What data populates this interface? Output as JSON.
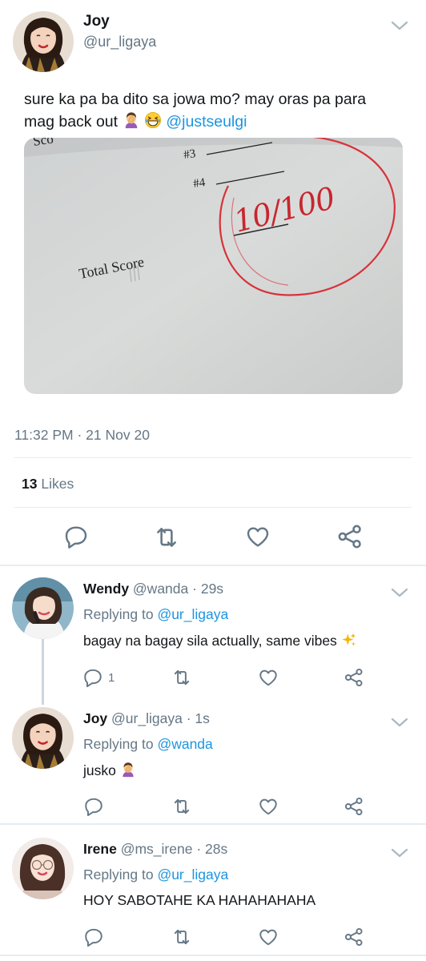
{
  "main_tweet": {
    "author_name": "Joy",
    "author_handle": "@ur_ligaya",
    "text_line1": "sure ka pa ba dito sa jowa mo? may oras pa para",
    "text_line2_prefix": "mag back out",
    "mention": "@justseulgi",
    "emojis": [
      "person-facepalming-emoji",
      "grinning-squinting-face-emoji"
    ],
    "image": {
      "label_score": "Sco",
      "label_3": "#3",
      "label_4": "#4",
      "label_total": "Total Score",
      "score": "10/100"
    },
    "timestamp": "11:32 PM · 21 Nov 20",
    "likes_count": "13",
    "likes_label": "Likes",
    "actions": [
      "reply-icon",
      "retweet-icon",
      "like-icon",
      "share-icon"
    ]
  },
  "replies": [
    {
      "author_name": "Wendy",
      "author_handle": "@wanda",
      "time": "· 29s",
      "replying_label": "Replying to",
      "replying_to": "@ur_ligaya",
      "text": "bagay na bagay sila actually, same vibes",
      "emoji": "sparkles-emoji",
      "reply_count": "1"
    },
    {
      "author_name": "Joy",
      "author_handle": "@ur_ligaya",
      "time": "· 1s",
      "replying_label": "Replying to",
      "replying_to": "@wanda",
      "text": "jusko",
      "emoji": "person-facepalming-emoji",
      "reply_count": ""
    },
    {
      "author_name": "Irene",
      "author_handle": "@ms_irene",
      "time": "· 28s",
      "replying_label": "Replying to",
      "replying_to": "@ur_ligaya",
      "text": "HOY SABOTAHE KA HAHAHAHAHA",
      "emoji": "",
      "reply_count": ""
    }
  ],
  "colors": {
    "accent": "#1b95e0",
    "icon_gray": "#657786",
    "divider": "#e6ecf0",
    "red_ink": "#d8323a"
  }
}
